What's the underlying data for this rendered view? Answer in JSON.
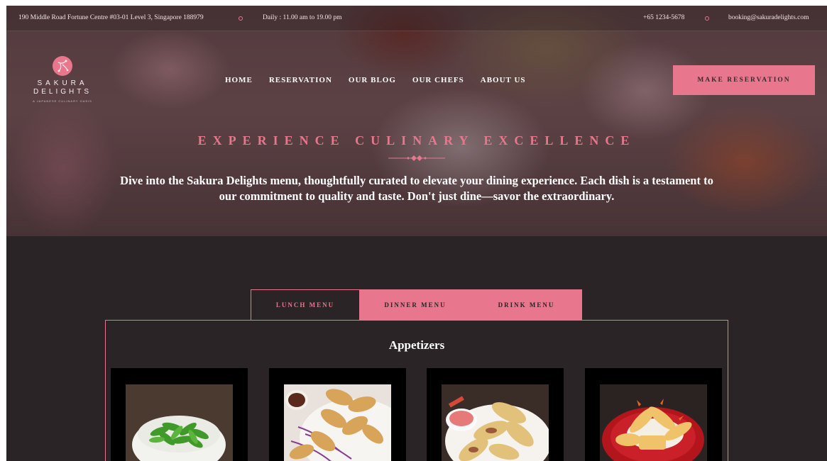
{
  "topbar": {
    "address": "190 Middle Road Fortune Centre #03-01 Level 3, Singapore 188979",
    "hours": "Daily : 11.00 am to 19.00 pm",
    "phone": "+65 1234-5678",
    "email": "booking@sakuradelights.com"
  },
  "brand": {
    "line1": "SAKURA",
    "line2": "DELIGHTS",
    "tagline": "A JAPANESE CULINARY OASIS"
  },
  "nav": {
    "items": [
      "HOME",
      "RESERVATION",
      "OUR BLOG",
      "OUR CHEFS",
      "ABOUT US"
    ]
  },
  "cta": {
    "label": "MAKE RESERVATION"
  },
  "hero": {
    "kicker": "EXPERIENCE CULINARY EXCELLENCE",
    "intro": "Dive into the Sakura Delights menu, thoughtfully curated to elevate your dining experience. Each dish is a testament to our commitment to quality and taste. Don't just dine—savor the extraordinary."
  },
  "menu": {
    "tabs": [
      "LUNCH MENU",
      "DINNER MENU",
      "DRINK MENU"
    ],
    "active_tab": "LUNCH MENU",
    "section_title": "Appetizers",
    "items": [
      {
        "photo": "edamame-photo"
      },
      {
        "photo": "gyoza-photo"
      },
      {
        "photo": "spring-rolls-photo"
      },
      {
        "photo": "tempura-photo"
      }
    ]
  },
  "colors": {
    "accent": "#e8778d",
    "background": "#2a2427",
    "card": "#000000"
  },
  "icons": [
    "sakura-logo-icon",
    "circle-separator-icon",
    "diamond-divider-icon"
  ]
}
